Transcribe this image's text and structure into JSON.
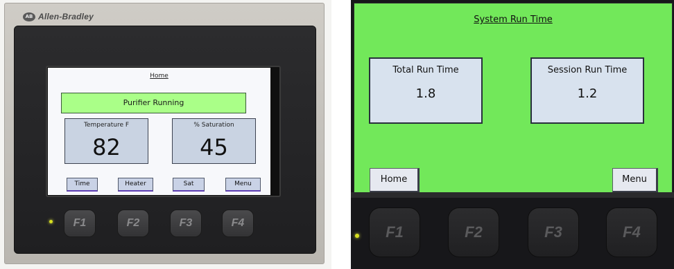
{
  "hmi_unit": {
    "brand_logo": "AB",
    "brand": "Allen-Bradley",
    "screen": {
      "title": "Home",
      "status": "Purifier Running",
      "temperature": {
        "label": "Temperature F",
        "value": "82"
      },
      "saturation": {
        "label": "% Saturation",
        "value": "45"
      },
      "buttons": [
        "Time",
        "Heater",
        "Sat",
        "Menu"
      ]
    },
    "function_keys": [
      "F1",
      "F2",
      "F3",
      "F4"
    ],
    "led_color": "#d8e020"
  },
  "zoomed_screen": {
    "title": "System Run Time",
    "total": {
      "label": "Total Run Time",
      "value": "1.8"
    },
    "session": {
      "label": "Session Run Time",
      "value": "1.2"
    },
    "buttons": {
      "home": "Home",
      "menu": "Menu"
    },
    "function_keys": [
      "F1",
      "F2",
      "F3",
      "F4"
    ],
    "background_color": "#72e85a"
  },
  "colors": {
    "status_bar": "#aaff88",
    "value_box": "#c9d3e2",
    "button_fill": "#c9d2e6"
  }
}
